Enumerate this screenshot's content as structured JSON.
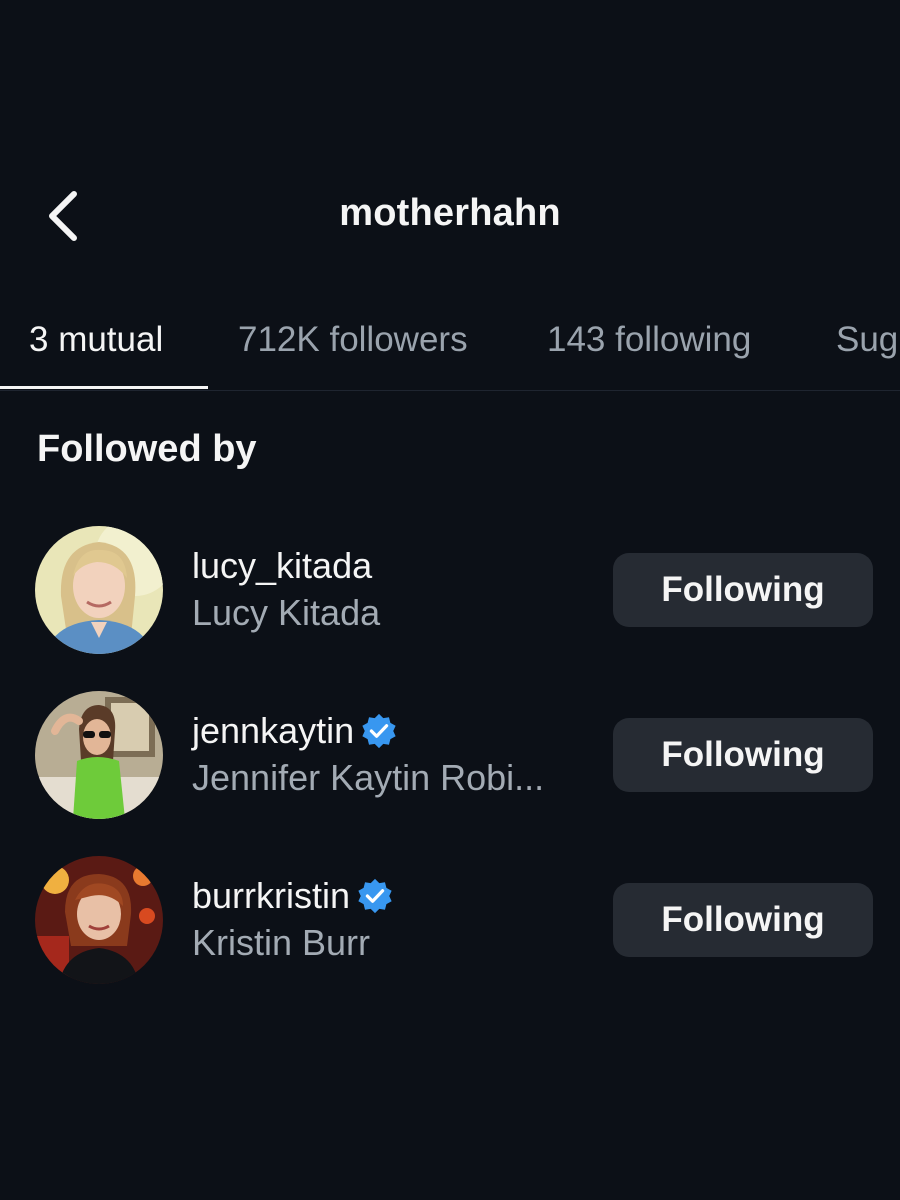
{
  "header": {
    "title": "motherhahn",
    "back_icon": "chevron-left-icon"
  },
  "tabs": [
    {
      "label": "3 mutual",
      "active": true
    },
    {
      "label": "712K followers",
      "active": false
    },
    {
      "label": "143 following",
      "active": false
    },
    {
      "label": "Sug",
      "active": false
    }
  ],
  "section": {
    "title": "Followed by"
  },
  "users": [
    {
      "username": "lucy_kitada",
      "full_name": "Lucy Kitada",
      "verified": false,
      "button_label": "Following"
    },
    {
      "username": "jennkaytin",
      "full_name": "Jennifer Kaytin Robi...",
      "verified": true,
      "button_label": "Following"
    },
    {
      "username": "burrkristin",
      "full_name": "Kristin Burr",
      "verified": true,
      "button_label": "Following"
    }
  ],
  "colors": {
    "background": "#0c1017",
    "button_bg": "#262b33",
    "verified_blue": "#3897f0",
    "secondary_text": "#a3abb4"
  }
}
